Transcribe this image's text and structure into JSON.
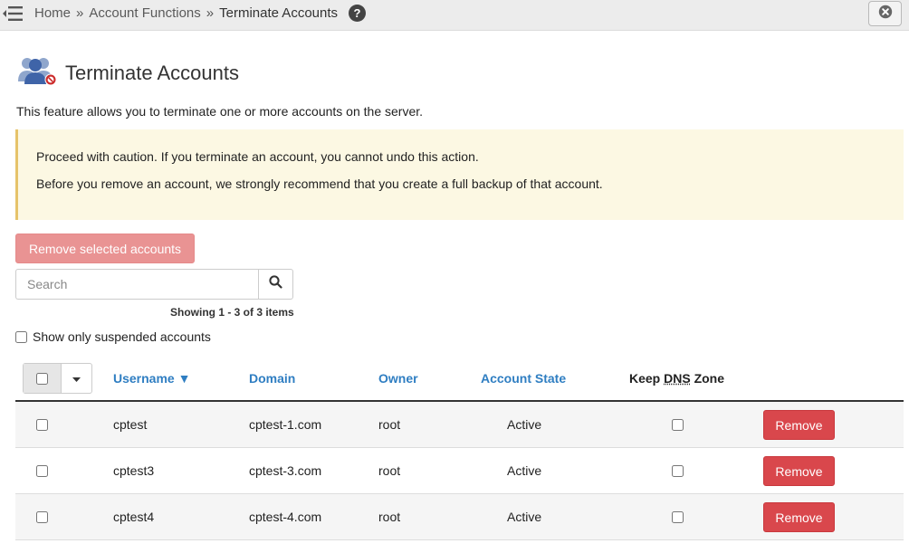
{
  "breadcrumb": {
    "items": [
      "Home",
      "Account Functions",
      "Terminate Accounts"
    ],
    "separator": "»"
  },
  "icons": {
    "menu": "menu-toggle-icon",
    "help": "help-icon",
    "close": "close-icon",
    "page": "users-terminate-icon",
    "search": "search-icon",
    "caret": "caret-down-icon"
  },
  "page": {
    "title": "Terminate Accounts",
    "description": "This feature allows you to terminate one or more accounts on the server."
  },
  "warning": {
    "line1": "Proceed with caution. If you terminate an account, you cannot undo this action.",
    "line2": "Before you remove an account, we strongly recommend that you create a full backup of that account."
  },
  "actions": {
    "remove_selected_label": "Remove selected accounts"
  },
  "search": {
    "placeholder": "Search",
    "value": ""
  },
  "pagination": {
    "showing": "Showing 1 - 3 of 3 items"
  },
  "filters": {
    "suspended_label": "Show only suspended accounts",
    "suspended_checked": false
  },
  "table": {
    "columns": {
      "username": "Username ▼",
      "domain": "Domain",
      "owner": "Owner",
      "state": "Account State",
      "keep_dns_prefix": "Keep ",
      "keep_dns_abbr": "DNS",
      "keep_dns_suffix": " Zone"
    },
    "rows": [
      {
        "username": "cptest",
        "domain": "cptest-1.com",
        "owner": "root",
        "state": "Active",
        "remove_label": "Remove"
      },
      {
        "username": "cptest3",
        "domain": "cptest-3.com",
        "owner": "root",
        "state": "Active",
        "remove_label": "Remove"
      },
      {
        "username": "cptest4",
        "domain": "cptest-4.com",
        "owner": "root",
        "state": "Active",
        "remove_label": "Remove"
      }
    ]
  },
  "colors": {
    "link": "#2f7ec2",
    "danger": "#d9474c",
    "danger_disabled": "#e99393",
    "warning_bg": "#fcf8e3"
  }
}
